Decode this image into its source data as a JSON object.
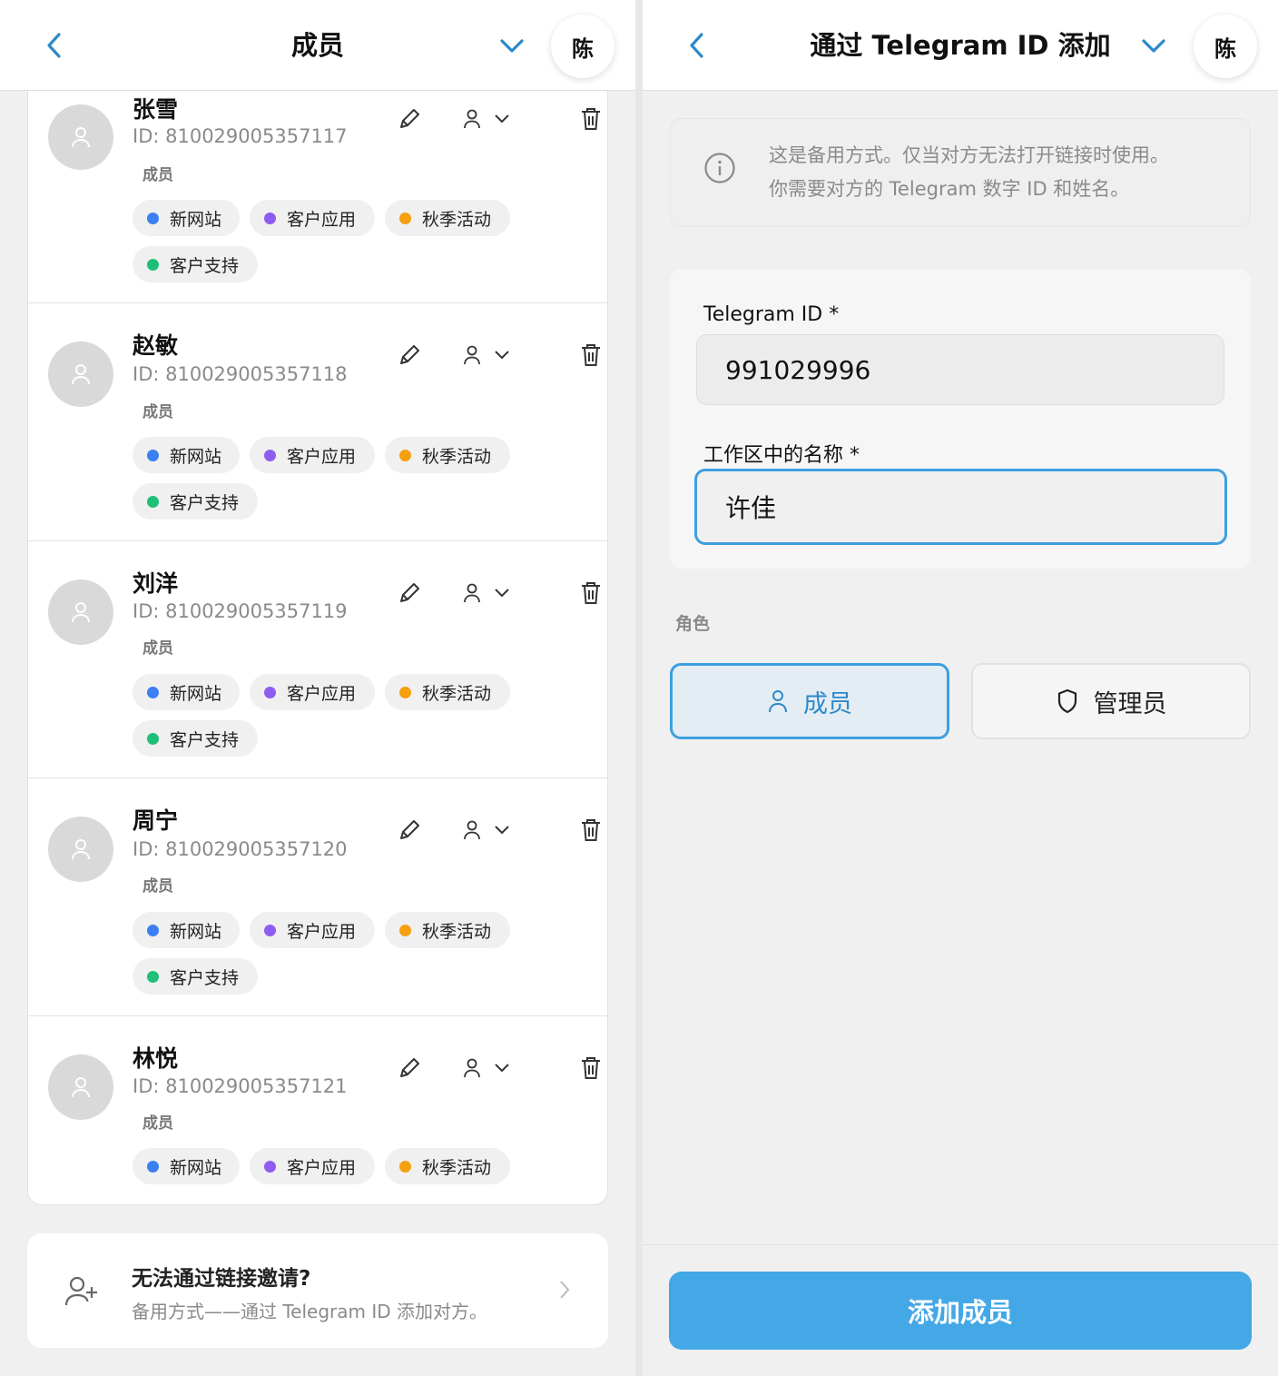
{
  "left_panel": {
    "header": {
      "title": "成员",
      "user_initial": "陈"
    },
    "members": [
      {
        "name": "张雪",
        "id": "ID: 810029005357117",
        "role": "成员"
      },
      {
        "name": "赵敏",
        "id": "ID: 810029005357118",
        "role": "成员"
      },
      {
        "name": "刘洋",
        "id": "ID: 810029005357119",
        "role": "成员"
      },
      {
        "name": "周宁",
        "id": "ID: 810029005357120",
        "role": "成员"
      },
      {
        "name": "林悦",
        "id": "ID: 810029005357121",
        "role": "成员"
      }
    ],
    "tags": [
      {
        "label": "新网站",
        "color": "#3b7ff2"
      },
      {
        "label": "客户应用",
        "color": "#8f5cf0"
      },
      {
        "label": "秋季活动",
        "color": "#f5a00f"
      },
      {
        "label": "客户支持",
        "color": "#1fbf78"
      }
    ],
    "invite_hint": {
      "title": "无法通过链接邀请?",
      "subtitle": "备用方式——通过 Telegram ID 添加对方。"
    }
  },
  "right_panel": {
    "header": {
      "title": "通过 Telegram ID 添加",
      "user_initial": "陈"
    },
    "info_lines": [
      "这是备用方式。仅当对方无法打开链接时使用。",
      "你需要对方的 Telegram 数字 ID 和姓名。"
    ],
    "form": {
      "telegram_id_label": "Telegram ID *",
      "telegram_id_value": "991029996",
      "name_label": "工作区中的名称 *",
      "name_value": "许佳"
    },
    "roles": {
      "label": "角色",
      "member_label": "成员",
      "admin_label": "管理员",
      "selected": "member"
    },
    "submit_label": "添加成员"
  },
  "colors": {
    "accent": "#3d9fe0",
    "button": "#44a7e6",
    "back_arrow": "#2d89c9"
  }
}
